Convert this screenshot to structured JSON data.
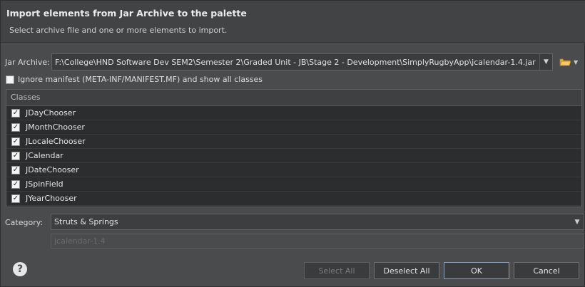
{
  "header": {
    "title": "Import elements from Jar Archive to the palette",
    "subtitle": "Select archive file and one or more elements to import."
  },
  "jar": {
    "label": "Jar Archive:",
    "value": "F:\\College\\HND Software Dev SEM2\\Semester 2\\Graded Unit - JB\\Stage 2 - Development\\SimplyRugbyApp\\jcalendar-1.4.jar"
  },
  "ignore_manifest": {
    "label": "Ignore manifest (META-INF/MANIFEST.MF) and show all classes",
    "checked": false
  },
  "classes": {
    "header": "Classes",
    "items": [
      {
        "label": "JDayChooser",
        "checked": true
      },
      {
        "label": "JMonthChooser",
        "checked": true
      },
      {
        "label": "JLocaleChooser",
        "checked": true
      },
      {
        "label": "JCalendar",
        "checked": true
      },
      {
        "label": "JDateChooser",
        "checked": true
      },
      {
        "label": "JSpinField",
        "checked": true
      },
      {
        "label": "JYearChooser",
        "checked": true
      }
    ]
  },
  "category": {
    "label": "Category:",
    "value": "Struts & Springs"
  },
  "library": {
    "value": "jcalendar-1.4"
  },
  "buttons": {
    "select_all": "Select All",
    "deselect_all": "Deselect All",
    "ok": "OK",
    "cancel": "Cancel"
  }
}
